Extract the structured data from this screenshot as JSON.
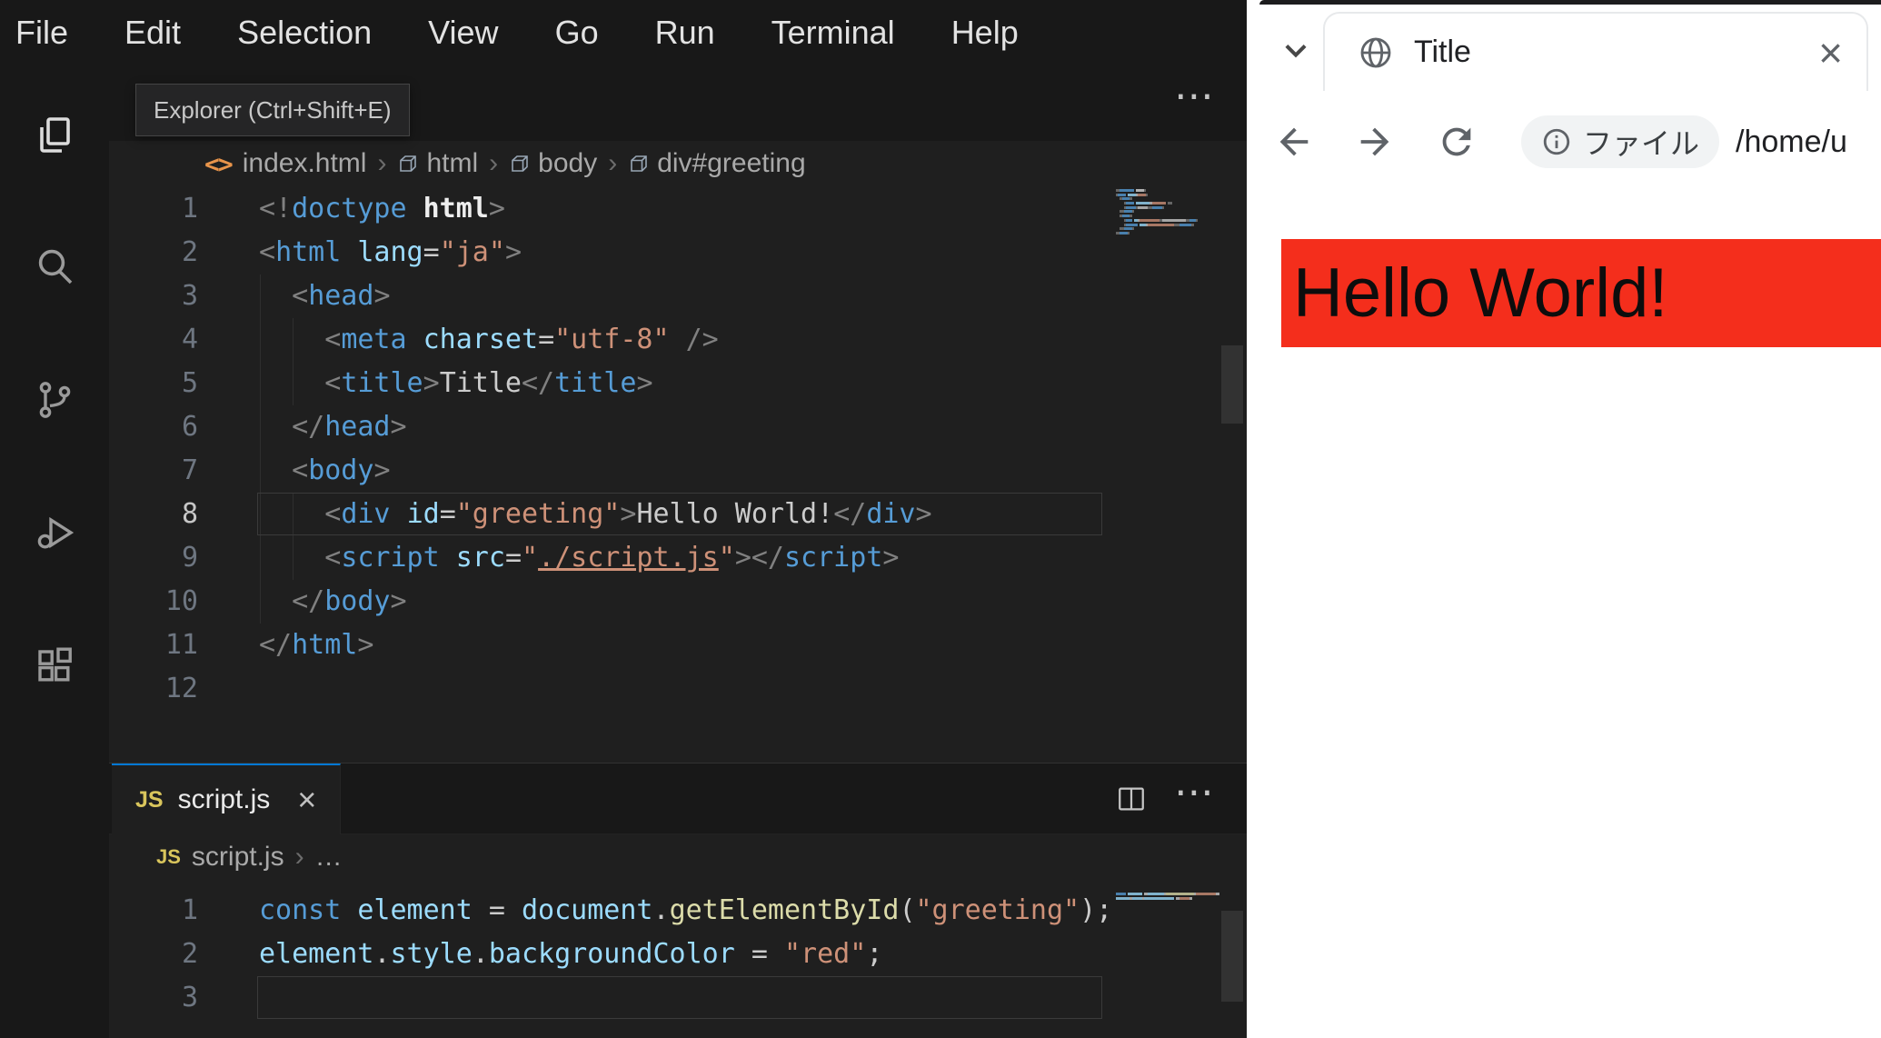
{
  "vscode": {
    "menu_items": [
      "File",
      "Edit",
      "Selection",
      "View",
      "Go",
      "Run",
      "Terminal",
      "Help"
    ],
    "activity_icons": [
      "explorer",
      "search",
      "source-control",
      "run-debug",
      "extensions"
    ],
    "tooltip": "Explorer (Ctrl+Shift+E)",
    "editor_actions_more": "⋯",
    "html_editor": {
      "breadcrumb": {
        "file_icon": "<>",
        "file": "index.html",
        "separator": "›",
        "path": [
          "html",
          "body",
          "div#greeting"
        ]
      },
      "current_line": 8,
      "lines": [
        {
          "n": "1",
          "tk": [
            [
              "p",
              "<!"
            ],
            [
              "tag",
              "doctype"
            ],
            [
              "w",
              " html"
            ],
            [
              "p",
              ">"
            ]
          ]
        },
        {
          "n": "2",
          "tk": [
            [
              "p",
              "<"
            ],
            [
              "tag",
              "html"
            ],
            [
              "t",
              " "
            ],
            [
              "attr",
              "lang"
            ],
            [
              "o",
              "="
            ],
            [
              "s",
              "\"ja\""
            ],
            [
              "p",
              ">"
            ]
          ]
        },
        {
          "n": "3",
          "tk": [
            [
              "p",
              "  <"
            ],
            [
              "tag",
              "head"
            ],
            [
              "p",
              ">"
            ]
          ]
        },
        {
          "n": "4",
          "tk": [
            [
              "p",
              "    <"
            ],
            [
              "tag",
              "meta"
            ],
            [
              "t",
              " "
            ],
            [
              "attr",
              "charset"
            ],
            [
              "o",
              "="
            ],
            [
              "s",
              "\"utf-8\""
            ],
            [
              "p",
              " />"
            ]
          ]
        },
        {
          "n": "5",
          "tk": [
            [
              "p",
              "    <"
            ],
            [
              "tag",
              "title"
            ],
            [
              "p",
              ">"
            ],
            [
              "t",
              "Title"
            ],
            [
              "p",
              "</"
            ],
            [
              "tag",
              "title"
            ],
            [
              "p",
              ">"
            ]
          ]
        },
        {
          "n": "6",
          "tk": [
            [
              "p",
              "  </"
            ],
            [
              "tag",
              "head"
            ],
            [
              "p",
              ">"
            ]
          ]
        },
        {
          "n": "7",
          "tk": [
            [
              "p",
              "  <"
            ],
            [
              "tag",
              "body"
            ],
            [
              "p",
              ">"
            ]
          ]
        },
        {
          "n": "8",
          "tk": [
            [
              "p",
              "    <"
            ],
            [
              "tag",
              "div"
            ],
            [
              "t",
              " "
            ],
            [
              "attr",
              "id"
            ],
            [
              "o",
              "="
            ],
            [
              "s",
              "\"greeting\""
            ],
            [
              "p",
              ">"
            ],
            [
              "t",
              "Hello World!"
            ],
            [
              "p",
              "</"
            ],
            [
              "tag",
              "div"
            ],
            [
              "p",
              ">"
            ]
          ]
        },
        {
          "n": "9",
          "tk": [
            [
              "p",
              "    <"
            ],
            [
              "tag",
              "script"
            ],
            [
              "t",
              " "
            ],
            [
              "attr",
              "src"
            ],
            [
              "o",
              "="
            ],
            [
              "s",
              "\""
            ],
            [
              "link",
              "./script.js"
            ],
            [
              "s",
              "\""
            ],
            [
              "p",
              "></"
            ],
            [
              "tag",
              "script"
            ],
            [
              "p",
              ">"
            ]
          ]
        },
        {
          "n": "10",
          "tk": [
            [
              "p",
              "  </"
            ],
            [
              "tag",
              "body"
            ],
            [
              "p",
              ">"
            ]
          ]
        },
        {
          "n": "11",
          "tk": [
            [
              "p",
              "</"
            ],
            [
              "tag",
              "html"
            ],
            [
              "p",
              ">"
            ]
          ]
        },
        {
          "n": "12",
          "tk": []
        }
      ]
    },
    "js_editor": {
      "tab": {
        "icon": "JS",
        "label": "script.js",
        "close": "×"
      },
      "breadcrumb": {
        "icon": "JS",
        "file": "script.js",
        "separator": "›",
        "more": "…"
      },
      "current_line": 3,
      "lines": [
        {
          "n": "1",
          "tk": [
            [
              "kw",
              "const"
            ],
            [
              "t",
              " "
            ],
            [
              "var",
              "element"
            ],
            [
              "o",
              " = "
            ],
            [
              "var",
              "document"
            ],
            [
              "o",
              "."
            ],
            [
              "fn",
              "getElementById"
            ],
            [
              "o",
              "("
            ],
            [
              "s",
              "\"greeting\""
            ],
            [
              "o",
              ");"
            ]
          ]
        },
        {
          "n": "2",
          "tk": [
            [
              "var",
              "element"
            ],
            [
              "o",
              "."
            ],
            [
              "var",
              "style"
            ],
            [
              "o",
              "."
            ],
            [
              "var",
              "backgroundColor"
            ],
            [
              "o",
              " = "
            ],
            [
              "s",
              "\"red\""
            ],
            [
              "o",
              ";"
            ]
          ]
        },
        {
          "n": "3",
          "tk": []
        }
      ]
    }
  },
  "browser": {
    "tab_title": "Title",
    "close_label": "×",
    "address": {
      "chip_label": "ファイル",
      "url": "/home/u"
    },
    "page": {
      "text": "Hello World!",
      "background": "#f42e1c"
    }
  },
  "colors": {
    "accent_blue": "#0078d4",
    "banner_red": "#f42e1c"
  }
}
